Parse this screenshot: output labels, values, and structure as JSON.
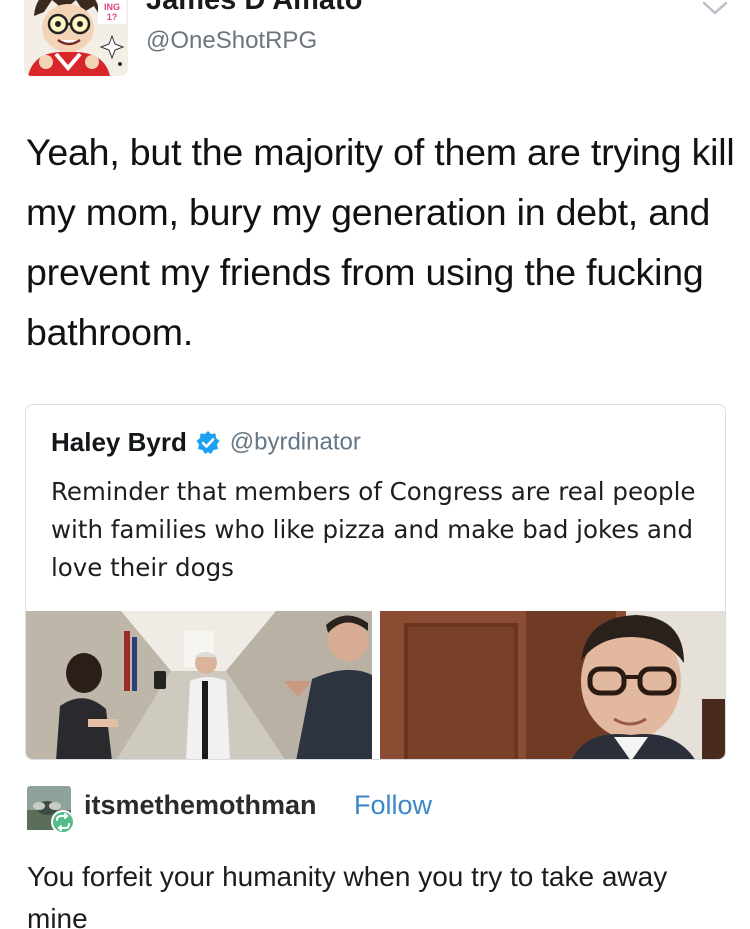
{
  "tweet": {
    "author_name": "James D'Amato",
    "author_handle": "@OneShotRPG",
    "avatar_badge_text": "KISS ING 1?",
    "text": "Yeah, but the majority of them are trying kill my mom, bury my generation in debt, and prevent my friends from using the fucking bathroom."
  },
  "quoted_tweet": {
    "author_name": "Haley Byrd",
    "author_handle": "@byrdinator",
    "verified": true,
    "text": "Reminder that members of Congress are real people with families who like pizza and make bad jokes and love their dogs"
  },
  "reblog": {
    "username": "itsmethemothman",
    "follow_label": "Follow",
    "text": "You forfeit your humanity when you try to take away mine"
  },
  "icons": {
    "verified": "verified-badge-icon",
    "menu": "chevron-down-icon",
    "reblog": "reblog-icon"
  },
  "colors": {
    "verified_blue": "#1da1f2",
    "follow_blue": "#3d86c9",
    "reblog_green": "#56bc8a"
  }
}
